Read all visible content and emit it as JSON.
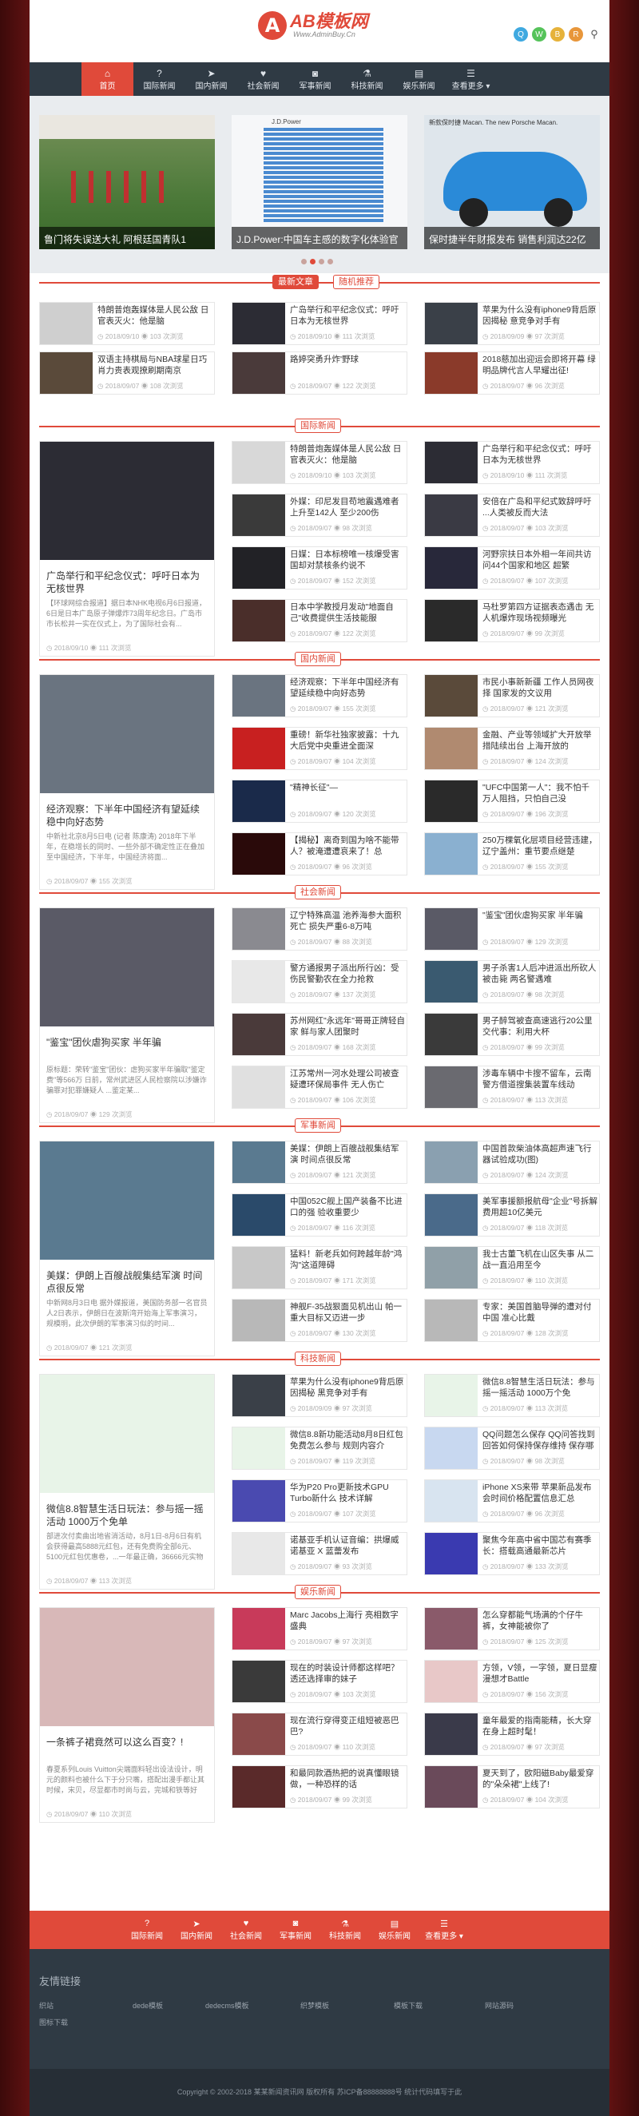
{
  "header": {
    "logo_letter": "A",
    "logo_name": "AB模板网",
    "logo_url": "Www.AdminBuy.Cn",
    "social": [
      {
        "icon": "qq-icon",
        "color": "#3fa9e0",
        "glyph": "Q"
      },
      {
        "icon": "wechat-icon",
        "color": "#55c35a",
        "glyph": "W"
      },
      {
        "icon": "weibo-icon",
        "color": "#e6b23a",
        "glyph": "B"
      },
      {
        "icon": "rss-icon",
        "color": "#e8963a",
        "glyph": "R"
      }
    ]
  },
  "nav": [
    {
      "label": "首页",
      "icon": "home-icon",
      "glyph": "⌂",
      "active": true
    },
    {
      "label": "国际新闻",
      "icon": "question-icon",
      "glyph": "?"
    },
    {
      "label": "国内新闻",
      "icon": "send-icon",
      "glyph": "➤"
    },
    {
      "label": "社会新闻",
      "icon": "heart-icon",
      "glyph": "♥"
    },
    {
      "label": "军事新闻",
      "icon": "camera-icon",
      "glyph": "◙"
    },
    {
      "label": "科技新闻",
      "icon": "flask-icon",
      "glyph": "⚗"
    },
    {
      "label": "娱乐新闻",
      "icon": "file-icon",
      "glyph": "▤"
    },
    {
      "label": "查看更多 ▾",
      "icon": "list-icon",
      "glyph": "☰"
    }
  ],
  "slider": [
    {
      "caption": "鲁门将失误送大礼 阿根廷国青队1",
      "bg": "#4d7a3a"
    },
    {
      "caption": "J.D.Power:中国车主感的数字化体验官",
      "bg": "#f4f6f8",
      "chart_title": "J.D.Power"
    },
    {
      "caption": "保时捷半年财报发布 销售利润达22亿",
      "bg": "#cfd8e0",
      "banner": "新款保时捷 Macan. The new Porsche Macan."
    }
  ],
  "tabs": {
    "latest": "最新文章",
    "random": "随机推荐"
  },
  "latest": [
    {
      "title": "特朗普炮轰媒体是人民公敌 日官表灭火：他是脑",
      "date": "2018/09/10",
      "views": "103 次浏览",
      "color": "#cfcfcf"
    },
    {
      "title": "广岛举行和平纪念仪式：呼吁日本为无核世界",
      "date": "2018/09/10",
      "views": "111 次浏览",
      "color": "#2c2c34"
    },
    {
      "title": "苹果为什么没有iphone9背后原因揭秘 意竞争对手有",
      "date": "2018/09/09",
      "views": "97 次浏览",
      "color": "#3a4048"
    },
    {
      "title": "双语主持棋局与NBA球星日巧肖力贵表观撩刷期南京",
      "date": "2018/09/07",
      "views": "108 次浏览",
      "color": "#5a4a3a"
    },
    {
      "title": "路婷突勇升炸'野球",
      "date": "2018/09/07",
      "views": "122 次浏览",
      "color": "#4a3a3a"
    },
    {
      "title": "2018慈加出迎运会即将开幕 绿明品牌代言人早耀出征!",
      "date": "2018/09/07",
      "views": "96 次浏览",
      "color": "#8a3a2a"
    }
  ],
  "sections": [
    {
      "label": "国际新闻",
      "big": {
        "title": "广岛举行和平纪念仪式：呼吁日本为无核世界",
        "desc": "【环球网综合报道】据日本NHK电视6月6日报道，6日是日本广岛原子弹爆炸73周年纪念日。广岛市市长松井一实在仪式上，为了国际社会有...",
        "date": "2018/09/10",
        "views": "111 次浏览",
        "color": "#2c2c34"
      },
      "items": [
        {
          "title": "特朗普炮轰媒体是人民公敌 日官表灭火：他是脑",
          "date": "2018/09/10",
          "views": "103 次浏览",
          "color": "#d8d8d8"
        },
        {
          "title": "广岛举行和平纪念仪式：呼吁日本为无核世界",
          "date": "2018/09/10",
          "views": "111 次浏览",
          "color": "#2c2c34"
        },
        {
          "title": "外媒：印尼发目苟地震遇难者上升至142人 至少200伤",
          "date": "2018/09/07",
          "views": "98 次浏览",
          "color": "#3a3a3a"
        },
        {
          "title": "安倍在广岛和平纪式致辞呼吁 ...人类被反而大法",
          "date": "2018/09/07",
          "views": "103 次浏览",
          "color": "#3a3a44"
        },
        {
          "title": "日媒：日本标榜唯一核爆受害国却对禁核条约说不",
          "date": "2018/09/07",
          "views": "152 次浏览",
          "color": "#222226"
        },
        {
          "title": "河野宗扶日本外相一年间共访问44个国家和地区 超繁",
          "date": "2018/09/07",
          "views": "107 次浏览",
          "color": "#28283a"
        },
        {
          "title": "日本中学教授月发动\"地面自己\"收费提供生活技能服",
          "date": "2018/09/07",
          "views": "122 次浏览",
          "color": "#4a2e2a"
        },
        {
          "title": "马杜罗第四方证据表态遇击 无人机爆炸现场视频曝光",
          "date": "2018/09/07",
          "views": "99 次浏览",
          "color": "#2a2a2a"
        }
      ]
    },
    {
      "label": "国内新闻",
      "big": {
        "title": "经济观察：下半年中国经济有望延续稳中向好态势",
        "desc": "中新社北京8月5日电 (记者 陈康涛) 2018年下半年，在稳增长的同时、一些外部不确定性正在叠加至中国经济，下半年，中国经济将面...",
        "date": "2018/09/07",
        "views": "155 次浏览",
        "color": "#6a7480"
      },
      "items": [
        {
          "title": "经济观察：下半年中国经济有望延续稳中向好态势",
          "date": "2018/09/07",
          "views": "155 次浏览",
          "color": "#6a7480"
        },
        {
          "title": "市民小事新新疆 工作人员网夜择 国家发的文议用",
          "date": "2018/09/07",
          "views": "121 次浏览",
          "color": "#5a4a3a"
        },
        {
          "title": "重磅！新华社独家披露：十九大后党中央重进全面深",
          "date": "2018/09/07",
          "views": "104 次浏览",
          "color": "#c82020"
        },
        {
          "title": "金融、产业等领域扩大开放举措陆续出台 上海开放的",
          "date": "2018/09/07",
          "views": "124 次浏览",
          "color": "#b08a70"
        },
        {
          "title": "\"精神长征\"—",
          "date": "2018/09/07",
          "views": "120 次浏览",
          "color": "#1a2a4a"
        },
        {
          "title": "\"UFC中国第一人\"：我不怕千万人阻挡，只怕自己没",
          "date": "2018/09/07",
          "views": "196 次浏览",
          "color": "#2a2a2a"
        },
        {
          "title": "【揭秘】离奇到国为啥不能带人？被淹遭遭哀来了！总",
          "date": "2018/09/07",
          "views": "96 次浏览",
          "color": "#2a0a0a"
        },
        {
          "title": "250万棵氧化层项目经营违建，辽宁盖州：重节要点继楚",
          "date": "2018/09/07",
          "views": "155 次浏览",
          "color": "#8ab0d0"
        }
      ]
    },
    {
      "label": "社会新闻",
      "big": {
        "title": "\"鉴宝\"团伙虐狗买家 半年骗",
        "desc": "原标题：荣转\"鉴宝\"团伙：虐狗买家半年骗取\"鉴定费\"等566万 日前，常州武进区人民检察院以涉嫌诈骗罪对犯罪嫌疑人 ...鉴定某...",
        "date": "2018/09/07",
        "views": "129 次浏览",
        "color": "#5a5a66"
      },
      "items": [
        {
          "title": "辽宁特殊高温 池养海参大面积死亡 损失严重6-8万吨",
          "date": "2018/09/07",
          "views": "88 次浏览",
          "color": "#8a8a90"
        },
        {
          "title": "\"鉴宝\"团伙虐狗买家 半年骗",
          "date": "2018/09/07",
          "views": "129 次浏览",
          "color": "#5a5a66"
        },
        {
          "title": "警方通报男子派出所行凶：受伤民警勤农在全力抢救",
          "date": "2018/09/07",
          "views": "137 次浏览",
          "color": "#e8e8e8"
        },
        {
          "title": "男子杀害1人后冲进派出所砍人 被击毙 两名警遇难",
          "date": "2018/09/07",
          "views": "98 次浏览",
          "color": "#3a5a70"
        },
        {
          "title": "苏州网红\"永远年\"哥哥正牌轻自家 鲜与家人团聚时",
          "date": "2018/09/07",
          "views": "168 次浏览",
          "color": "#4a3a3a"
        },
        {
          "title": "男子醉驾被查高速逃行20公里 交代事：利用大杯",
          "date": "2018/09/07",
          "views": "99 次浏览",
          "color": "#3a3a3a"
        },
        {
          "title": "江苏常州一河水处理公司被查 疑遭环保局事件 无人伤亡",
          "date": "2018/09/07",
          "views": "106 次浏览",
          "color": "#e0e0e0"
        },
        {
          "title": "涉毒车辆中卡搜不留车，云南警方借道搜集装置车线动",
          "date": "2018/09/07",
          "views": "113 次浏览",
          "color": "#6a6a70"
        }
      ]
    },
    {
      "label": "军事新闻",
      "big": {
        "title": "美媒：伊朗上百艘战舰集结军演 时间点很反常",
        "desc": "中新网8月3日电 据外媒报道，美国防务部一名官员人2日表示，伊朗日在波斯湾开始海上军事演习，规模明，此次伊朗的军事演习似的时间...",
        "date": "2018/09/07",
        "views": "121 次浏览",
        "color": "#5a7a90"
      },
      "items": [
        {
          "title": "美媒：伊朗上百艘战舰集结军演 时间点很反常",
          "date": "2018/09/07",
          "views": "121 次浏览",
          "color": "#5a7a90"
        },
        {
          "title": "中国首款柴油体高超声速飞行器试验成功(图)",
          "date": "2018/09/07",
          "views": "124 次浏览",
          "color": "#8aa0b0"
        },
        {
          "title": "中国052C舰上国产装备不比进口的强 验收重要少",
          "date": "2018/09/07",
          "views": "116 次浏览",
          "color": "#2a4a6a"
        },
        {
          "title": "美军事援额报航母\"企业\"号拆解费用超10亿美元",
          "date": "2018/09/07",
          "views": "118 次浏览",
          "color": "#4a6a8a"
        },
        {
          "title": "猛料！新老兵如何跨越年龄\"鸿沟\"这道障碍",
          "date": "2018/09/07",
          "views": "171 次浏览",
          "color": "#c8c8c8"
        },
        {
          "title": "我士古董飞机在山区失事 从二战一直沿用至今",
          "date": "2018/09/07",
          "views": "110 次浏览",
          "color": "#90a0a8"
        },
        {
          "title": "神舰F-35战狠面见机出山 帕一重大目标又迈进一步",
          "date": "2018/09/07",
          "views": "130 次浏览",
          "color": "#b8b8b8"
        },
        {
          "title": "专家：美国首脑导弹的遭对付中国 准心比戴",
          "date": "2018/09/07",
          "views": "128 次浏览",
          "color": "#b8b8b8"
        }
      ]
    },
    {
      "label": "科技新闻",
      "big": {
        "title": "微信8.8智慧生活日玩法：参与摇一摇活动 1000万个免单",
        "desc": "部进次付卖曲出地省消活动，8月1日-8月6日有机会获得最高5888元红包，还有免费购全部6元、5100元红包优惠卷，...一年最正确，36666元实物奖金...",
        "date": "2018/09/07",
        "views": "113 次浏览",
        "color": "#e8f4e8"
      },
      "items": [
        {
          "title": "苹果为什么没有iphone9背后原因揭秘 黑竞争对手有",
          "date": "2018/09/09",
          "views": "97 次浏览",
          "color": "#3a4048"
        },
        {
          "title": "微信8.8智慧生活日玩法：参与摇一摇活动 1000万个免",
          "date": "2018/09/07",
          "views": "113 次浏览",
          "color": "#e8f4e8"
        },
        {
          "title": "微信8.8新功能活动8月8日红包免费怎么参与 规则内容介",
          "date": "2018/09/07",
          "views": "119 次浏览",
          "color": "#e8f4e8"
        },
        {
          "title": "QQ问题怎么保存 QQ问答找到回答如何保持保存维持 保存哪面方法分享",
          "date": "2018/09/07",
          "views": "98 次浏览",
          "color": "#c8d8f0"
        },
        {
          "title": "华为P20 Pro更新技术GPU Turbo新什么 技术详解",
          "date": "2018/09/07",
          "views": "107 次浏览",
          "color": "#4a4ab0"
        },
        {
          "title": "iPhone XS来带 苹果新品发布会时间价格配置信息汇总",
          "date": "2018/09/07",
          "views": "96 次浏览",
          "color": "#d8e4f0"
        },
        {
          "title": "诺基亚手机认证音编：拱爆威诺基亚 X 蓝蕾发布",
          "date": "2018/09/07",
          "views": "93 次浏览",
          "color": "#e8e8e8"
        },
        {
          "title": "聚焦今年高中省中国芯有赛季长：搭载高通最新芯片",
          "date": "2018/09/07",
          "views": "133 次浏览",
          "color": "#3a3ab0"
        }
      ]
    },
    {
      "label": "娱乐新闻",
      "big": {
        "title": "一条裤子裙竟然可以这么百变？!",
        "desc": "春夏系列Louis Vuitton尖端面料轻出设法设计，明元的颜料也被什么下于分只嘴，搭配出漫手都让其时候，宋贝，尽显都市时尚与云，完城和铁等好起...",
        "date": "2018/09/07",
        "views": "110 次浏览",
        "color": "#d8b8b8"
      },
      "items": [
        {
          "title": "Marc Jacobs上海行 亮相数字盛典",
          "date": "2018/09/07",
          "views": "97 次浏览",
          "color": "#c83a5a"
        },
        {
          "title": "怎么穿都能气场满的个仔牛裤，女神能被你了",
          "date": "2018/09/07",
          "views": "125 次浏览",
          "color": "#8a5a6a"
        },
        {
          "title": "现在的时装设计师都这样吧？ 透还选择审的妹子",
          "date": "2018/09/07",
          "views": "103 次浏览",
          "color": "#3a3a3a"
        },
        {
          "title": "方领，V领，一字领，夏日显瘦漫想才Battle",
          "date": "2018/09/07",
          "views": "156 次浏览",
          "color": "#e8c8c8"
        },
        {
          "title": "现在流行穿得变正组短被恶巴巴?",
          "date": "2018/09/07",
          "views": "110 次浏览",
          "color": "#8a4a4a"
        },
        {
          "title": "童年最爱的指南能精，长大穿在身上超时髦！",
          "date": "2018/09/07",
          "views": "97 次浏览",
          "color": "#3a3a4a"
        },
        {
          "title": "和最同款酒热把的说真懂眼镜做，一种恐样的话",
          "date": "2018/09/07",
          "views": "99 次浏览",
          "color": "#5a2a2a"
        },
        {
          "title": "夏天到了，欧阳磁Baby最爱穿的\"朵朵裙\"上线了!",
          "date": "2018/09/07",
          "views": "104 次浏览",
          "color": "#6a4a5a"
        }
      ]
    }
  ],
  "footer_nav": [
    {
      "label": "国际新闻",
      "icon": "question-icon",
      "glyph": "?"
    },
    {
      "label": "国内新闻",
      "icon": "send-icon",
      "glyph": "➤"
    },
    {
      "label": "社会新闻",
      "icon": "heart-icon",
      "glyph": "♥"
    },
    {
      "label": "军事新闻",
      "icon": "camera-icon",
      "glyph": "◙"
    },
    {
      "label": "科技新闻",
      "icon": "flask-icon",
      "glyph": "⚗"
    },
    {
      "label": "娱乐新闻",
      "icon": "file-icon",
      "glyph": "▤"
    },
    {
      "label": "查看更多 ▾",
      "icon": "list-icon",
      "glyph": "☰"
    }
  ],
  "friend_links": {
    "title": "友情链接",
    "items": [
      "织站",
      "dede模板",
      "dedecms模板",
      "织梦模板",
      "模板下载",
      "网站源码",
      "图标下载"
    ]
  },
  "copyright": "Copyright © 2002-2018 某某新闻资讯网 版权所有  苏ICP备88888888号  统计代码填写于此"
}
